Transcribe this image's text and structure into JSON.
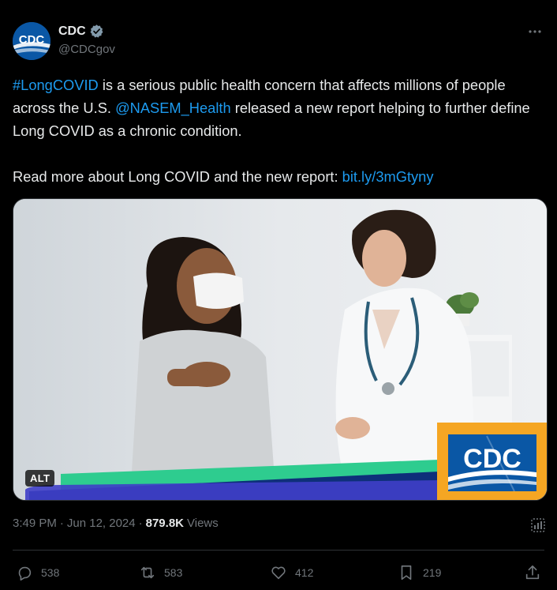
{
  "author": {
    "name": "CDC",
    "handle": "@CDCgov",
    "avatar_text": "CDC"
  },
  "tweet": {
    "hashtag": "#LongCOVID",
    "text_1": " is a serious public health concern that affects millions of people across the U.S. ",
    "mention": "@NASEM_Health",
    "text_2": " released a new report helping to further define Long COVID as a chronic condition.",
    "text_3": "Read more about Long COVID and the new report: ",
    "link": "bit.ly/3mGtyny"
  },
  "media": {
    "alt_label": "ALT",
    "logo_text": "CDC"
  },
  "meta": {
    "time": "3:49 PM",
    "separator": "·",
    "date": "Jun 12, 2024",
    "views_count": "879.8K",
    "views_label": "Views"
  },
  "actions": {
    "replies": "538",
    "reposts": "583",
    "likes": "412",
    "bookmarks": "219"
  },
  "colors": {
    "link": "#1d9bf0",
    "secondary_text": "#71767b",
    "divider": "#2f3336",
    "cdc_blue": "#0a57a5",
    "cdc_orange": "#f5a623"
  }
}
